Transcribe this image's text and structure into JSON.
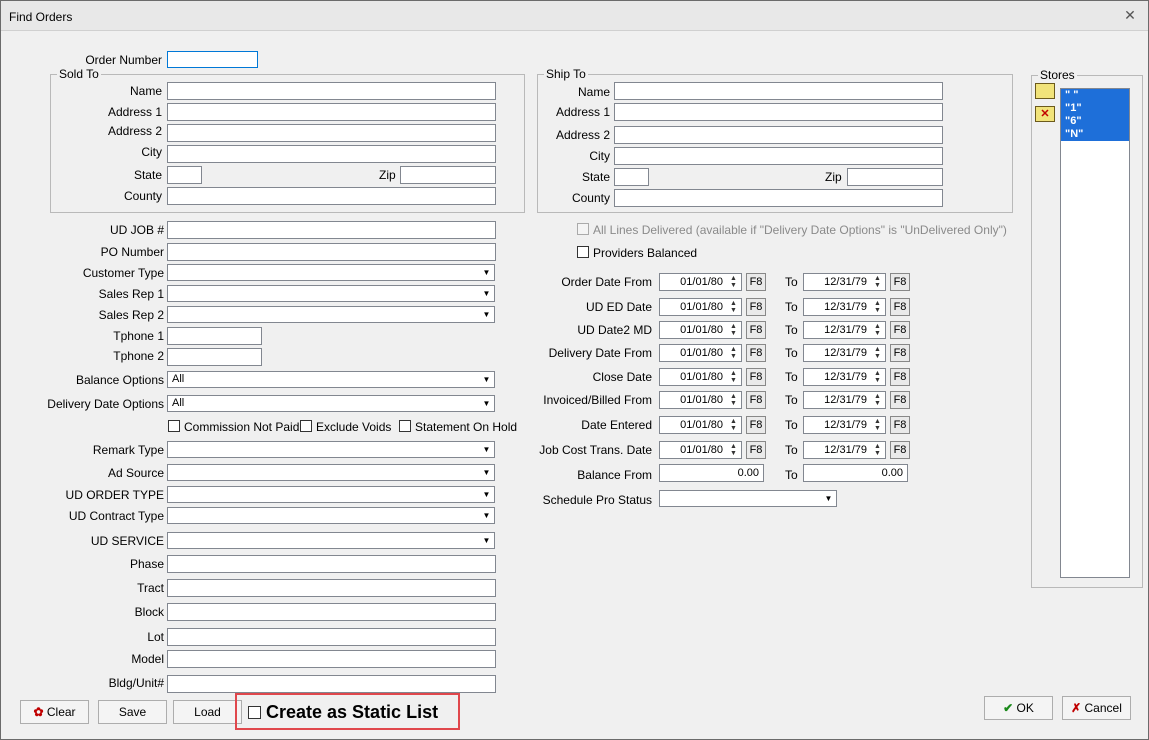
{
  "window": {
    "title": "Find Orders"
  },
  "order_number": {
    "label": "Order Number",
    "value": ""
  },
  "sold_to": {
    "legend": "Sold To",
    "name_label": "Name",
    "address1_label": "Address 1",
    "address2_label": "Address 2",
    "city_label": "City",
    "state_label": "State",
    "zip_label": "Zip",
    "county_label": "County"
  },
  "ship_to": {
    "legend": "Ship To",
    "name_label": "Name",
    "address1_label": "Address 1",
    "address2_label": "Address 2",
    "city_label": "City",
    "state_label": "State",
    "zip_label": "Zip",
    "county_label": "County"
  },
  "fields": {
    "ud_job": "UD JOB #",
    "po_number": "PO Number",
    "customer_type": "Customer Type",
    "sales_rep1": "Sales Rep 1",
    "sales_rep2": "Sales Rep 2",
    "tphone1": "Tphone 1",
    "tphone2": "Tphone 2",
    "balance_options": "Balance Options",
    "balance_options_value": "All",
    "delivery_date_options": "Delivery Date Options",
    "delivery_date_options_value": "All",
    "commission_not_paid": "Commission Not Paid",
    "exclude_voids": "Exclude Voids",
    "statement_on_hold": "Statement On Hold",
    "remark_type": "Remark Type",
    "ad_source": "Ad Source",
    "ud_order_type": "UD ORDER TYPE",
    "ud_contract_type": "UD Contract Type",
    "ud_service": "UD SERVICE",
    "phase": "Phase",
    "tract": "Tract",
    "block": "Block",
    "lot": "Lot",
    "model": "Model",
    "bldg_unit": "Bldg/Unit#"
  },
  "right": {
    "all_lines_delivered": "All Lines Delivered (available if \"Delivery Date Options\" is \"UnDelivered Only\")",
    "providers_balanced": "Providers Balanced",
    "to_label": "To",
    "f8_label": "F8",
    "date_rows": [
      {
        "label": "Order Date From",
        "from": "01/01/80",
        "to": "12/31/79"
      },
      {
        "label": "UD ED Date",
        "from": "01/01/80",
        "to": "12/31/79"
      },
      {
        "label": "UD Date2 MD",
        "from": "01/01/80",
        "to": "12/31/79"
      },
      {
        "label": "Delivery Date From",
        "from": "01/01/80",
        "to": "12/31/79"
      },
      {
        "label": "Close Date",
        "from": "01/01/80",
        "to": "12/31/79"
      },
      {
        "label": "Invoiced/Billed From",
        "from": "01/01/80",
        "to": "12/31/79"
      },
      {
        "label": "Date Entered",
        "from": "01/01/80",
        "to": "12/31/79"
      },
      {
        "label": "Job Cost Trans. Date",
        "from": "01/01/80",
        "to": "12/31/79"
      }
    ],
    "balance_from": {
      "label": "Balance From",
      "from": "0.00",
      "to": "0.00"
    },
    "schedule_pro_status": "Schedule Pro Status"
  },
  "stores": {
    "legend": "Stores",
    "items": [
      "\" \"",
      "\"1\"",
      "\"6\"",
      "\"N\""
    ]
  },
  "buttons": {
    "clear": "Clear",
    "save": "Save",
    "load": "Load",
    "ok": "OK",
    "cancel": "Cancel"
  },
  "static_list": {
    "label": "Create as Static List"
  },
  "colors": {
    "selection": "#1e6fd9",
    "highlight_box": "#e0474c",
    "ok_check": "#1a8a1a",
    "cancel_x": "#c00000"
  }
}
